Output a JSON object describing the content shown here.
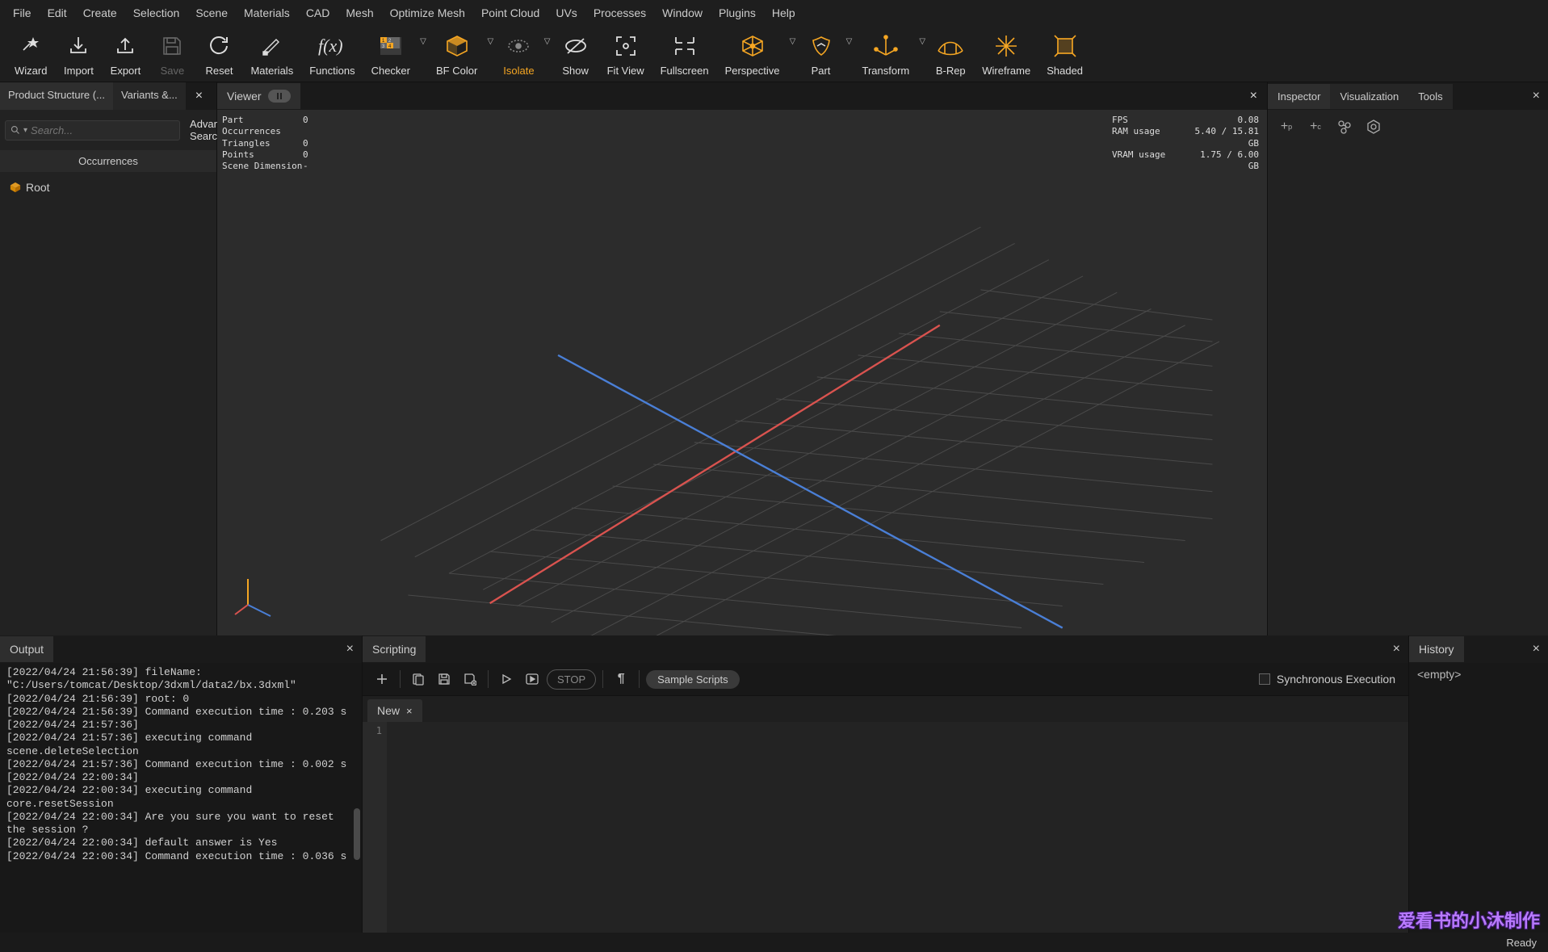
{
  "menu": [
    "File",
    "Edit",
    "Create",
    "Selection",
    "Scene",
    "Materials",
    "CAD",
    "Mesh",
    "Optimize Mesh",
    "Point Cloud",
    "UVs",
    "Processes",
    "Window",
    "Plugins",
    "Help"
  ],
  "toolbar": [
    {
      "id": "wizard",
      "label": "Wizard",
      "dd": false
    },
    {
      "id": "import",
      "label": "Import",
      "dd": false
    },
    {
      "id": "export",
      "label": "Export",
      "dd": false
    },
    {
      "id": "save",
      "label": "Save",
      "dd": false,
      "disabled": true
    },
    {
      "id": "reset",
      "label": "Reset",
      "dd": false
    },
    {
      "id": "materials",
      "label": "Materials",
      "dd": false
    },
    {
      "id": "functions",
      "label": "Functions",
      "dd": false
    },
    {
      "id": "checker",
      "label": "Checker",
      "dd": true
    },
    {
      "id": "bfcolor",
      "label": "BF Color",
      "dd": true
    },
    {
      "id": "isolate",
      "label": "Isolate",
      "dd": true,
      "iso": true
    },
    {
      "id": "show",
      "label": "Show",
      "dd": false
    },
    {
      "id": "fitview",
      "label": "Fit View",
      "dd": false
    },
    {
      "id": "fullscreen",
      "label": "Fullscreen",
      "dd": false
    },
    {
      "id": "perspective",
      "label": "Perspective",
      "dd": true
    },
    {
      "id": "part",
      "label": "Part",
      "dd": true
    },
    {
      "id": "transform",
      "label": "Transform",
      "dd": true
    },
    {
      "id": "brep",
      "label": "B-Rep",
      "dd": false
    },
    {
      "id": "wireframe",
      "label": "Wireframe",
      "dd": false
    },
    {
      "id": "shaded",
      "label": "Shaded",
      "dd": false
    }
  ],
  "left": {
    "tabs": {
      "structure": "Product Structure (...",
      "variants": "Variants &..."
    },
    "search_placeholder": "Search...",
    "adv": "Advanced Search",
    "occ_header": "Occurrences",
    "root": "Root"
  },
  "viewer": {
    "tab": "Viewer",
    "stats_left": [
      {
        "k": "Part Occurrences",
        "v": "0"
      },
      {
        "k": "Triangles",
        "v": "0"
      },
      {
        "k": "Points",
        "v": "0"
      },
      {
        "k": "Scene Dimension",
        "v": "-"
      }
    ],
    "stats_right": [
      {
        "k": "FPS",
        "v": "0.08"
      },
      {
        "k": "RAM usage",
        "v": "5.40 / 15.81 GB"
      },
      {
        "k": "VRAM usage",
        "v": "1.75 / 6.00 GB"
      }
    ]
  },
  "right": {
    "tabs": [
      "Inspector",
      "Visualization",
      "Tools"
    ]
  },
  "output": {
    "tab": "Output",
    "log": "[2022/04/24 21:56:39] fileName: \"C:/Users/tomcat/Desktop/3dxml/data2/bx.3dxml\"\n[2022/04/24 21:56:39] root: 0\n[2022/04/24 21:56:39] Command execution time : 0.203 s\n[2022/04/24 21:57:36]\n[2022/04/24 21:57:36] executing command scene.deleteSelection\n[2022/04/24 21:57:36] Command execution time : 0.002 s\n[2022/04/24 22:00:34]\n[2022/04/24 22:00:34] executing command core.resetSession\n[2022/04/24 22:00:34] Are you sure you want to reset the session ?\n[2022/04/24 22:00:34] default answer is Yes\n[2022/04/24 22:00:34] Command execution time : 0.036 s"
  },
  "scripting": {
    "tab": "Scripting",
    "stop": "STOP",
    "sample": "Sample Scripts",
    "sync": "Synchronous Execution",
    "newtab": "New",
    "line1": "1"
  },
  "history": {
    "tab": "History",
    "empty": "<empty>"
  },
  "status": "Ready",
  "watermark": "爱看书的小沐制作"
}
